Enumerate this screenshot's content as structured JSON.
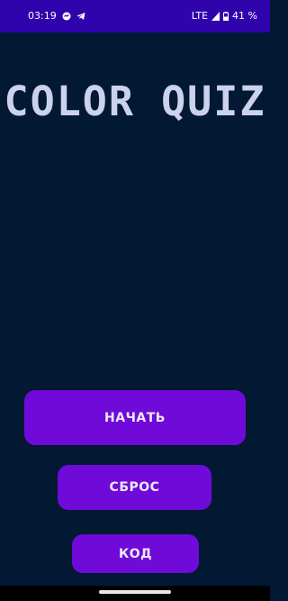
{
  "status_bar": {
    "time": "03:19",
    "network": "LTE",
    "battery": "41 %",
    "icons": [
      "messenger-icon",
      "telegram-icon",
      "signal-icon",
      "battery-icon"
    ]
  },
  "title": "COLOR QUIZ",
  "buttons": {
    "start": "НАЧАТЬ",
    "reset": "СБРОС",
    "code": "КОД"
  },
  "colors": {
    "background": "#021833",
    "status_bar": "#2f04ad",
    "button": "#6f0ad8",
    "title_text": "#ccd2eb"
  }
}
